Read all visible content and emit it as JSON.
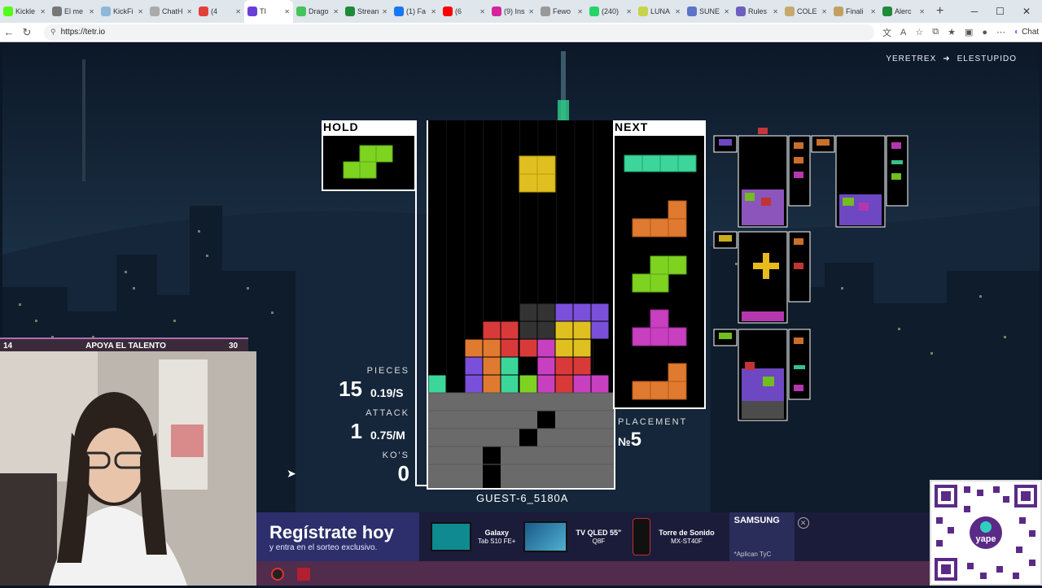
{
  "browser": {
    "tabs": [
      {
        "label": "Kickle",
        "color": "#53fc18"
      },
      {
        "label": "El me",
        "color": "#777777"
      },
      {
        "label": "KickFi",
        "color": "#8fb7d8"
      },
      {
        "label": "ChatH",
        "color": "#aaaaaa"
      },
      {
        "label": "(4",
        "color": "#e0413a"
      },
      {
        "label": "TI",
        "color": "#6a3fd9"
      },
      {
        "label": "Drago",
        "color": "#45c45a"
      },
      {
        "label": "Strean",
        "color": "#1f8a3a"
      },
      {
        "label": "(1) Fa",
        "color": "#1877f2"
      },
      {
        "label": "(6",
        "color": "#ff0000"
      },
      {
        "label": "(9) Ins",
        "color": "#d6249f"
      },
      {
        "label": "Fewo",
        "color": "#999999"
      },
      {
        "label": "(240)",
        "color": "#25d366"
      },
      {
        "label": "LUNA",
        "color": "#c7d44a"
      },
      {
        "label": "SUNE",
        "color": "#5b74c8"
      },
      {
        "label": "Rules",
        "color": "#6d5fbd"
      },
      {
        "label": "COLE",
        "color": "#c8a96b"
      },
      {
        "label": "Finali",
        "color": "#c4a060"
      },
      {
        "label": "Alerc",
        "color": "#1f8a3a"
      }
    ],
    "url": "https://tetr.io",
    "chat_label": "Chat"
  },
  "game": {
    "route_from": "YERETREX",
    "route_to": "ELESTUPIDO",
    "hold_label": "HOLD",
    "next_label": "NEXT",
    "pieces_label": "PIECES",
    "pieces_value": "15",
    "pieces_rate": "0.19/S",
    "attack_label": "ATTACK",
    "attack_value": "1",
    "attack_rate": "0.75/M",
    "kos_label": "KO'S",
    "kos_value": "0",
    "placement_label": "PLACEMENT",
    "placement_prefix": "№",
    "placement_value": "5",
    "player_name": "GUEST-6_5180A"
  },
  "overlay": {
    "talent_level": "14",
    "talent_title": "APOYA EL TALENTO",
    "talent_count": "30"
  },
  "ad": {
    "headline": "Regístrate hoy",
    "subline": "y entra en el sorteo exclusivo.",
    "products": [
      {
        "name": "Galaxy",
        "detail": "Tab S10 FE+"
      },
      {
        "name": "TV QLED 55\"",
        "detail": "Q8F"
      },
      {
        "name": "Torre de Sonido",
        "detail": "MX-ST40F"
      }
    ],
    "brand": "SAMSUNG",
    "disclaimer": "*Aplican TyC"
  },
  "colors": {
    "accent": "#b06fb0",
    "green": "#7ed321",
    "cyan": "#3dd69a",
    "orange": "#e07a30",
    "red": "#e03a3a",
    "purple": "#8a3fd9",
    "magenta": "#c83fc0",
    "yellow": "#e0c020",
    "garbage": "#6a6a6a"
  }
}
